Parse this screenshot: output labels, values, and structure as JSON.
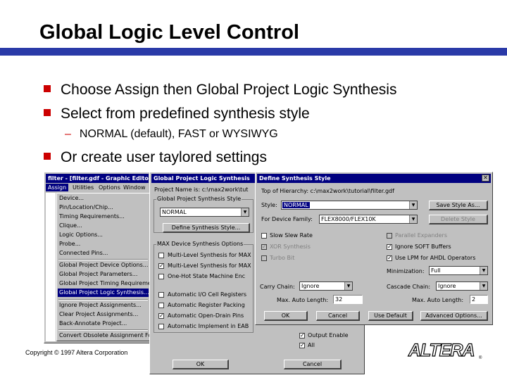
{
  "slide": {
    "title": "Global Logic Level Control",
    "bullets": [
      "Choose Assign then Global Project Logic Synthesis",
      "Select from predefined synthesis style",
      "Or create user taylored settings"
    ],
    "sub_bullet": "NORMAL (default), FAST or WYSIWYG",
    "copyright": "Copyright © 1997 Altera Corporation",
    "logo_text": "ALTERA",
    "accent_bar_color": "#2a3aa8",
    "bullet_color": "#cc0000"
  },
  "graphic_editor": {
    "title": "filter - [filter.gdf - Graphic Editor]",
    "menus": [
      "Assign",
      "Utilities",
      "Options",
      "Window"
    ],
    "menu_items": [
      "Device...",
      "Pin/Location/Chip...",
      "Timing Requirements...",
      "Clique...",
      "Logic Options...",
      "Probe...",
      "Connected Pins...",
      "Global Project Device Options...",
      "Global Project Parameters...",
      "Global Project Timing Requirements...",
      "Global Project Logic Synthesis...",
      "Ignore Project Assignments...",
      "Clear Project Assignments...",
      "Back-Annotate Project...",
      "Convert Obsolete Assignment Format..."
    ]
  },
  "logic_synthesis": {
    "title": "Global Project Logic Synthesis",
    "project_name_label": "Project Name is: c:\\max2work\\tut",
    "synthesis_style_group": "Global Project Synthesis Style",
    "style_value": "NORMAL",
    "define_button": "Define Synthesis Style...",
    "max_group": "MAX Device Synthesis Options",
    "options": [
      {
        "label": "Multi-Level Synthesis for MAX",
        "checked": false
      },
      {
        "label": "Multi-Level Synthesis for MAX",
        "checked": true
      },
      {
        "label": "One-Hot State Machine Enc",
        "checked": false
      },
      {
        "label": "Automatic I/O Cell Registers",
        "checked": false
      },
      {
        "label": "Automatic Register Packing",
        "checked": false
      },
      {
        "label": "Automatic Open-Drain Pins",
        "checked": true
      },
      {
        "label": "Automatic Implement in EAB",
        "checked": false
      }
    ],
    "extra_options": [
      {
        "label": "Output Enable",
        "checked": true
      },
      {
        "label": "All",
        "checked": true
      }
    ],
    "ok_button": "OK",
    "cancel_button": "Cancel"
  },
  "define_style": {
    "title": "Define Synthesis Style",
    "top_hierarchy_label": "Top of Hierarchy: c:\\max2work\\tutorial\\filter.gdf",
    "style_label": "Style:",
    "style_value": "NORMAL",
    "save_style_button": "Save Style As...",
    "delete_style_button": "Delete Style",
    "family_label": "For Device Family:",
    "family_value": "FLEX8000/FLEX10K",
    "left_options": [
      {
        "label": "Slow Slew Rate",
        "checked": false,
        "disabled": false
      },
      {
        "label": "XOR Synthesis",
        "checked": true,
        "disabled": true
      },
      {
        "label": "Turbo Bit",
        "checked": false,
        "disabled": true
      }
    ],
    "right_options": [
      {
        "label": "Parallel Expanders",
        "checked": false,
        "disabled": true
      },
      {
        "label": "Ignore SOFT Buffers",
        "checked": true,
        "disabled": false
      },
      {
        "label": "Use LPM for AHDL Operators",
        "checked": true,
        "disabled": false
      }
    ],
    "minimization_label": "Minimization:",
    "minimization_value": "Full",
    "carry_chain_label": "Carry Chain:",
    "carry_chain_value": "Ignore",
    "carry_len_label": "Max. Auto Length:",
    "carry_len_value": "32",
    "cascade_chain_label": "Cascade Chain:",
    "cascade_chain_value": "Ignore",
    "cascade_len_label": "Max. Auto Length:",
    "cascade_len_value": "2",
    "ok_button": "OK",
    "cancel_button": "Cancel",
    "use_default_button": "Use Default",
    "advanced_button": "Advanced Options..."
  }
}
